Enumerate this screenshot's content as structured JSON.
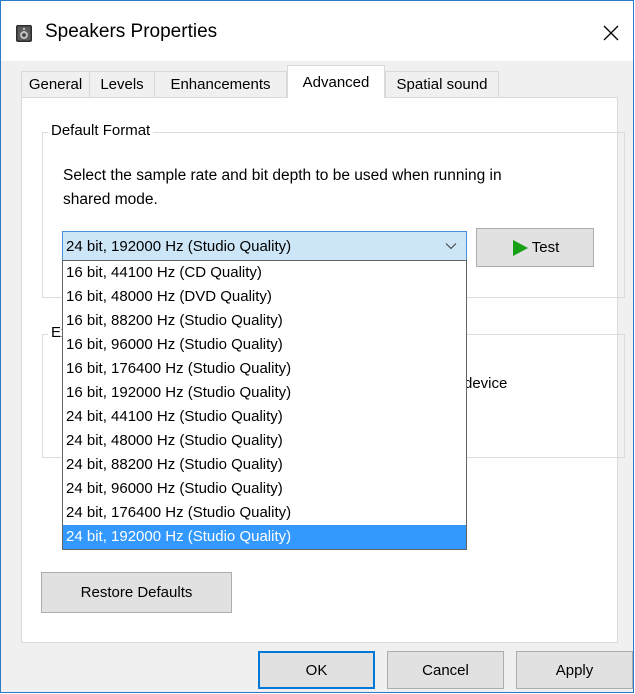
{
  "window": {
    "title": "Speakers Properties",
    "close_glyph": "✕",
    "icons": {
      "app": "speaker-icon",
      "close": "close-icon"
    }
  },
  "tabs": [
    {
      "label": "General",
      "active": false
    },
    {
      "label": "Levels",
      "active": false
    },
    {
      "label": "Enhancements",
      "active": false
    },
    {
      "label": "Advanced",
      "active": true
    },
    {
      "label": "Spatial sound",
      "active": false
    }
  ],
  "default_format": {
    "group_label": "Default Format",
    "description": "Select the sample rate and bit depth to be used when running in shared mode.",
    "selected_value": "24 bit, 192000 Hz (Studio Quality)",
    "test_label": "Test",
    "options": [
      "16 bit, 44100 Hz (CD Quality)",
      "16 bit, 48000 Hz (DVD Quality)",
      "16 bit, 88200 Hz (Studio Quality)",
      "16 bit, 96000 Hz (Studio Quality)",
      "16 bit, 176400 Hz (Studio Quality)",
      "16 bit, 192000 Hz (Studio Quality)",
      "24 bit, 44100 Hz (Studio Quality)",
      "24 bit, 48000 Hz (Studio Quality)",
      "24 bit, 88200 Hz (Studio Quality)",
      "24 bit, 96000 Hz (Studio Quality)",
      "24 bit, 176400 Hz (Studio Quality)",
      "24 bit, 192000 Hz (Studio Quality)"
    ],
    "selected_index": 11
  },
  "exclusive": {
    "group_label_partial": "Ex",
    "text_partial": "device"
  },
  "buttons": {
    "restore": "Restore Defaults",
    "ok": "OK",
    "cancel": "Cancel",
    "apply": "Apply"
  },
  "colors": {
    "accent": "#0078d7",
    "selection": "#3399ff",
    "play_green": "#16a016"
  }
}
